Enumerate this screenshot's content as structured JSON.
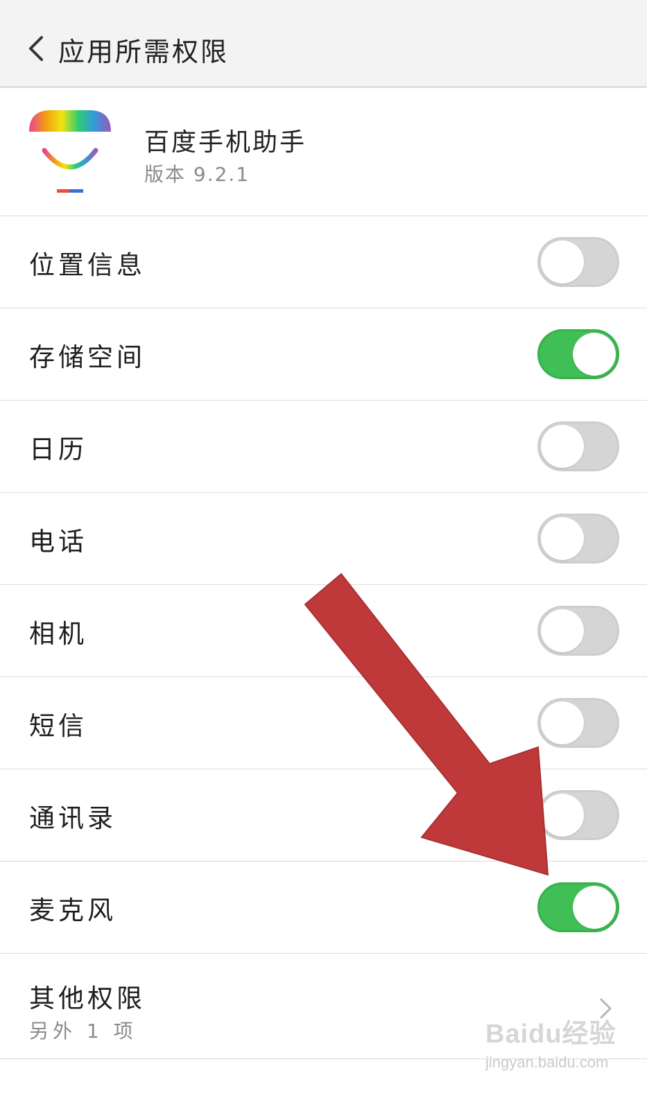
{
  "header": {
    "title": "应用所需权限",
    "back_icon": "chevron-left-icon"
  },
  "app": {
    "name": "百度手机助手",
    "version": "版本 9.2.1",
    "icon": "baidu-app-store-logo"
  },
  "permissions": [
    {
      "label": "位置信息",
      "enabled": false
    },
    {
      "label": "存储空间",
      "enabled": true
    },
    {
      "label": "日历",
      "enabled": false
    },
    {
      "label": "电话",
      "enabled": false
    },
    {
      "label": "相机",
      "enabled": false
    },
    {
      "label": "短信",
      "enabled": false
    },
    {
      "label": "通讯录",
      "enabled": false
    },
    {
      "label": "麦克风",
      "enabled": true
    }
  ],
  "other_permissions": {
    "title": "其他权限",
    "subtitle": "另外 1 项",
    "icon": "chevron-right-icon"
  },
  "watermark": {
    "logo": "Baidu经验",
    "url": "jingyan.baidu.com"
  },
  "colors": {
    "toggle_on": "#3fbf55",
    "toggle_off": "#d5d5d5",
    "arrow": "#c0393a",
    "header_bg": "#f3f3f3"
  }
}
